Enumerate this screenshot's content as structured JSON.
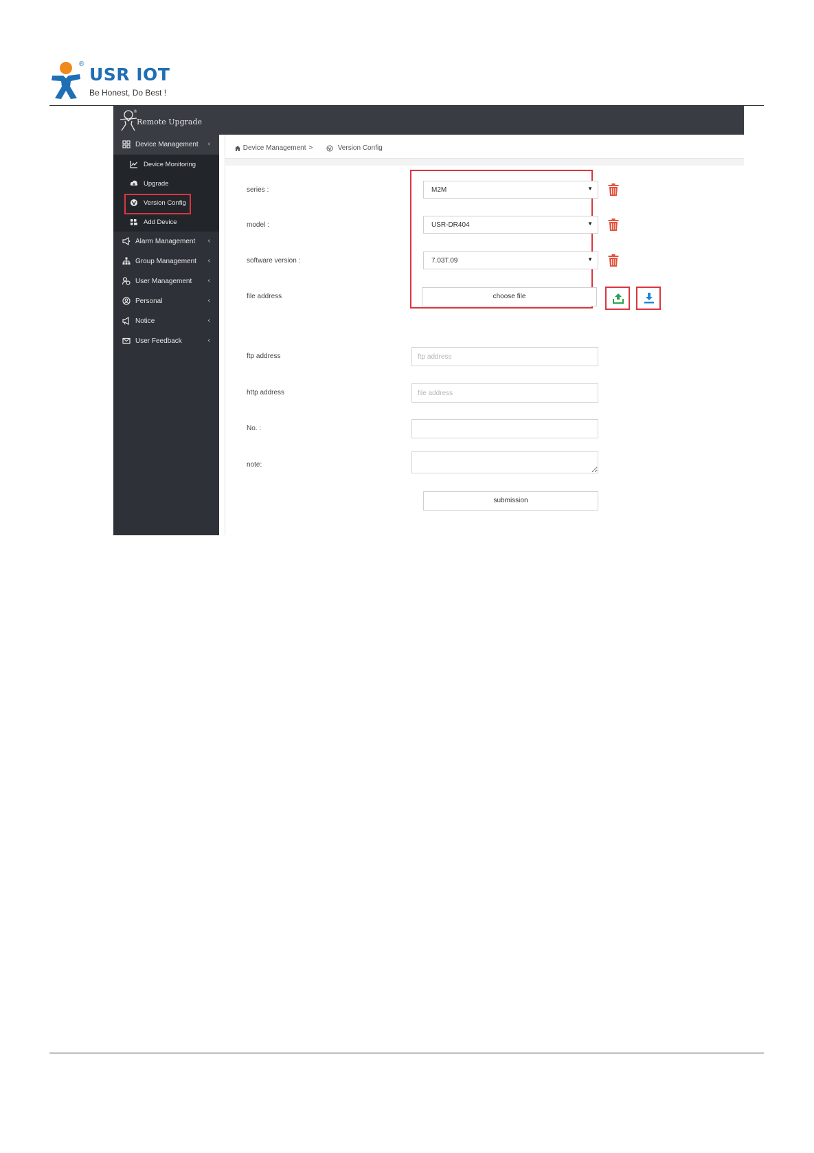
{
  "brand": {
    "logo_text": "USR IOT",
    "registered": "®",
    "slogan": "Be Honest, Do Best !"
  },
  "app": {
    "title": "Remote Upgrade"
  },
  "sidebar": {
    "items": [
      {
        "label": "Device Management",
        "icon": "grid-icon",
        "chevron": "‹"
      },
      {
        "label": "Alarm Management",
        "icon": "megaphone-icon",
        "chevron": "‹"
      },
      {
        "label": "Group Management",
        "icon": "sitemap-icon",
        "chevron": "‹"
      },
      {
        "label": "User Management",
        "icon": "users-icon",
        "chevron": "‹"
      },
      {
        "label": "Personal",
        "icon": "user-circle-icon",
        "chevron": "‹"
      },
      {
        "label": "Notice",
        "icon": "bullhorn-icon",
        "chevron": "‹"
      },
      {
        "label": "User Feedback",
        "icon": "envelope-icon",
        "chevron": "‹"
      }
    ],
    "sub_items": [
      {
        "label": "Device Monitoring",
        "icon": "line-chart-icon"
      },
      {
        "label": "Upgrade",
        "icon": "cloud-upload-icon"
      },
      {
        "label": "Version Config",
        "icon": "version-icon"
      },
      {
        "label": "Add Device",
        "icon": "add-users-icon"
      }
    ]
  },
  "breadcrumb": {
    "parent": "Device Management",
    "separator": ">",
    "current": "Version Config"
  },
  "form": {
    "series_label": "series :",
    "series_value": "M2M",
    "model_label": "model :",
    "model_value": "USR-DR404",
    "software_label": "software version :",
    "software_value": "7.03T.09",
    "file_label": "file address",
    "choose_file_label": "choose file",
    "ftp_label": "ftp address",
    "ftp_placeholder": "ftp address",
    "http_label": "http address",
    "http_placeholder": "file address",
    "no_label": "No. :",
    "note_label": "note:",
    "submit_label": "submission",
    "caret": "▼"
  },
  "colors": {
    "highlight": "#d9363e",
    "trash": "#e2543f",
    "upload": "#2aa44f",
    "download": "#1f86d6",
    "sidebar": "#2e3238",
    "topbar": "#393d43",
    "brand_blue": "#1f6fb5",
    "brand_orange": "#f08a1c"
  }
}
